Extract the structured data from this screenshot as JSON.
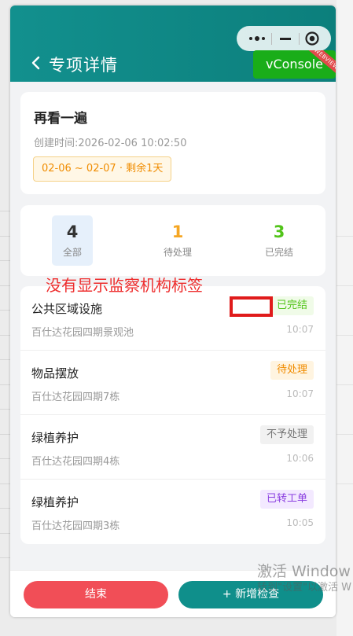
{
  "header": {
    "title": "专项详情"
  },
  "dev": {
    "vconsole_label": "vConsole",
    "vconsole_ribbon": "WEBVIEW"
  },
  "inspection": {
    "title": "再看一遍",
    "created_label": "创建时间:",
    "created_at": "2026-02-06 10:02:50",
    "date_range": "02-06 ~ 02-07 · 剩余1天"
  },
  "stats": [
    {
      "count": "4",
      "label": "全部",
      "color": "#333333",
      "active": true
    },
    {
      "count": "1",
      "label": "待处理",
      "color": "#f5a623",
      "active": false
    },
    {
      "count": "3",
      "label": "已完结",
      "color": "#52c41a",
      "active": false
    }
  ],
  "annotation": {
    "text": "没有显示监察机构标签",
    "color": "#ee2d2d"
  },
  "items": [
    {
      "name": "公共区域设施",
      "address": "百仕达花园四期景观池",
      "time": "10:07",
      "status": "已完结"
    },
    {
      "name": "物品摆放",
      "address": "百仕达花园四期7栋",
      "time": "10:07",
      "status": "待处理"
    },
    {
      "name": "绿植养护",
      "address": "百仕达花园四期4栋",
      "time": "10:06",
      "status": "不予处理"
    },
    {
      "name": "绿植养护",
      "address": "百仕达花园四期3栋",
      "time": "10:05",
      "status": "已转工单"
    }
  ],
  "actions": {
    "end_label": "结束",
    "add_label": "+ 新增检查"
  },
  "colors": {
    "header": "#0f8a87",
    "end_button": "#f14e57",
    "add_button": "#0f8f8b"
  },
  "os_watermark": {
    "line1": "激活 Window",
    "line2": "转到\"设置\"以激活 W"
  }
}
